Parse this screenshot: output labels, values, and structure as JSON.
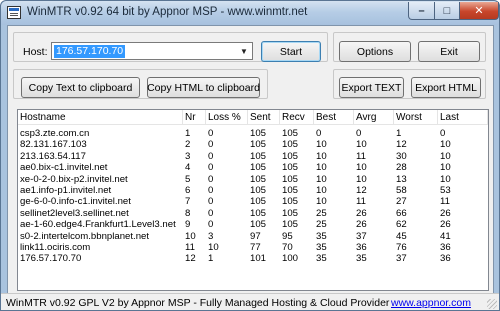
{
  "window": {
    "title": "WinMTR v0.92 64 bit by Appnor MSP - www.winmtr.net",
    "min_glyph": "–",
    "max_glyph": "□",
    "close_glyph": "✕"
  },
  "host": {
    "label": "Host:",
    "value": "176.57.170.70",
    "dropdown_glyph": "▼"
  },
  "buttons": {
    "start": "Start",
    "options": "Options",
    "exit": "Exit",
    "copy_text": "Copy Text to clipboard",
    "copy_html": "Copy HTML to clipboard",
    "export_text": "Export TEXT",
    "export_html": "Export HTML"
  },
  "table": {
    "columns": [
      "Hostname",
      "Nr",
      "Loss %",
      "Sent",
      "Recv",
      "Best",
      "Avrg",
      "Worst",
      "Last"
    ],
    "rows": [
      [
        "csp3.zte.com.cn",
        "1",
        "0",
        "105",
        "105",
        "0",
        "0",
        "1",
        "0"
      ],
      [
        "82.131.167.103",
        "2",
        "0",
        "105",
        "105",
        "10",
        "10",
        "12",
        "10"
      ],
      [
        "213.163.54.117",
        "3",
        "0",
        "105",
        "105",
        "10",
        "11",
        "30",
        "10"
      ],
      [
        "ae0.bix-c1.invitel.net",
        "4",
        "0",
        "105",
        "105",
        "10",
        "10",
        "28",
        "10"
      ],
      [
        "xe-0-2-0.bix-p2.invitel.net",
        "5",
        "0",
        "105",
        "105",
        "10",
        "10",
        "13",
        "10"
      ],
      [
        "ae1.info-p1.invitel.net",
        "6",
        "0",
        "105",
        "105",
        "10",
        "12",
        "58",
        "53"
      ],
      [
        "ge-6-0-0.info-c1.invitel.net",
        "7",
        "0",
        "105",
        "105",
        "10",
        "11",
        "27",
        "11"
      ],
      [
        "sellinet2level3.sellinet.net",
        "8",
        "0",
        "105",
        "105",
        "25",
        "26",
        "66",
        "26"
      ],
      [
        "ae-1-60.edge4.Frankfurt1.Level3.net",
        "9",
        "0",
        "105",
        "105",
        "25",
        "26",
        "62",
        "26"
      ],
      [
        "s0-2.intertelcom.bbnplanet.net",
        "10",
        "3",
        "97",
        "95",
        "35",
        "37",
        "45",
        "41"
      ],
      [
        "link11.ociris.com",
        "11",
        "10",
        "77",
        "70",
        "35",
        "36",
        "76",
        "36"
      ],
      [
        "176.57.170.70",
        "12",
        "1",
        "101",
        "100",
        "35",
        "35",
        "37",
        "36"
      ]
    ]
  },
  "status": {
    "text": "WinMTR v0.92 GPL V2 by Appnor MSP - Fully Managed Hosting & Cloud Provider",
    "link": "www.appnor.com"
  }
}
